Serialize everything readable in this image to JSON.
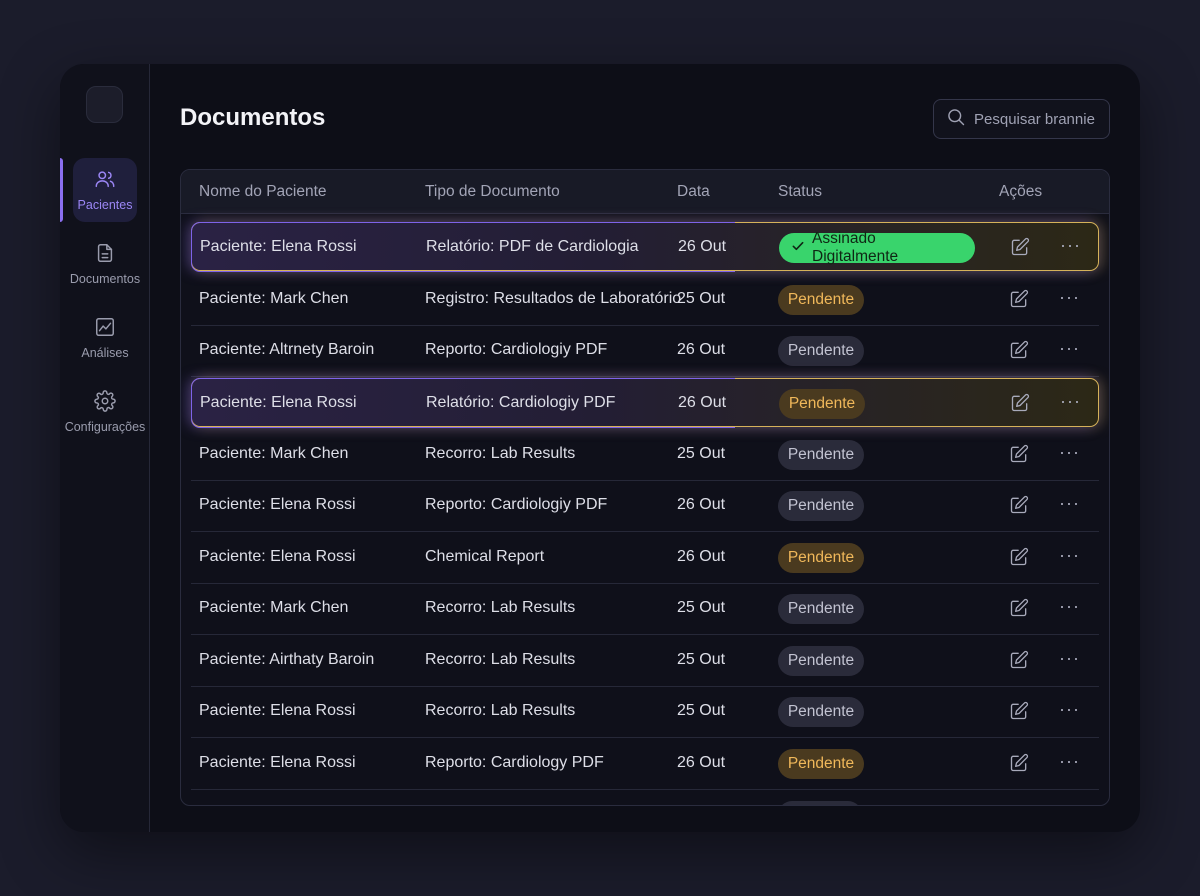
{
  "sidebar": {
    "items": [
      {
        "label": "Pacientes",
        "icon": "users-icon",
        "active": true
      },
      {
        "label": "Documentos",
        "icon": "file-icon",
        "active": false
      },
      {
        "label": "Análises",
        "icon": "chart-icon",
        "active": false
      },
      {
        "label": "Configurações",
        "icon": "gear-icon",
        "active": false
      }
    ]
  },
  "header": {
    "title": "Documentos",
    "search_placeholder": "Pesquisar brannie"
  },
  "table": {
    "columns": [
      "Nome do Paciente",
      "Tipo de Documento",
      "Data",
      "Status",
      "Ações"
    ],
    "rows": [
      {
        "patient": "Paciente: Elena Rossi",
        "doc": "Relatório: PDF de Cardiologia",
        "date": "26 Out",
        "status": "Assinado Digitalmente",
        "status_style": "signed",
        "highlight": true
      },
      {
        "patient": "Paciente: Mark Chen",
        "doc": "Registro: Resultados de Laboratório",
        "date": "25 Out",
        "status": "Pendente",
        "status_style": "pend-amber",
        "highlight": false
      },
      {
        "patient": "Paciente: Altrnety Baroin",
        "doc": "Reporto: Cardiologiy PDF",
        "date": "26 Out",
        "status": "Pendente",
        "status_style": "pend-gray",
        "highlight": false
      },
      {
        "patient": "Paciente: Elena Rossi",
        "doc": "Relatório: Cardiologiy PDF",
        "date": "26 Out",
        "status": "Pendente",
        "status_style": "pend-amber",
        "highlight": true
      },
      {
        "patient": "Paciente: Mark Chen",
        "doc": "Recorro: Lab Results",
        "date": "25 Out",
        "status": "Pendente",
        "status_style": "pend-gray",
        "highlight": false
      },
      {
        "patient": "Paciente: Elena Rossi",
        "doc": "Reporto: Cardiologiy PDF",
        "date": "26 Out",
        "status": "Pendente",
        "status_style": "pend-gray",
        "highlight": false
      },
      {
        "patient": "Paciente: Elena Rossi",
        "doc": "Chemical Report",
        "date": "26 Out",
        "status": "Pendente",
        "status_style": "pend-amber",
        "highlight": false
      },
      {
        "patient": "Paciente: Mark Chen",
        "doc": "Recorro: Lab Results",
        "date": "25 Out",
        "status": "Pendente",
        "status_style": "pend-gray",
        "highlight": false
      },
      {
        "patient": "Paciente: Airthaty Baroin",
        "doc": "Recorro: Lab Results",
        "date": "25 Out",
        "status": "Pendente",
        "status_style": "pend-gray",
        "highlight": false
      },
      {
        "patient": "Paciente: Elena Rossi",
        "doc": "Recorro: Lab Results",
        "date": "25 Out",
        "status": "Pendente",
        "status_style": "pend-gray",
        "highlight": false
      },
      {
        "patient": "Paciente: Elena Rossi",
        "doc": "Reporto: Cardiology PDF",
        "date": "26 Out",
        "status": "Pendente",
        "status_style": "pend-amber",
        "highlight": false
      }
    ]
  },
  "colors": {
    "accent": "#8b6ff0",
    "signed": "#39d46c",
    "pending_amber": "#f0b85a",
    "highlight_border": "#d6b25a"
  }
}
